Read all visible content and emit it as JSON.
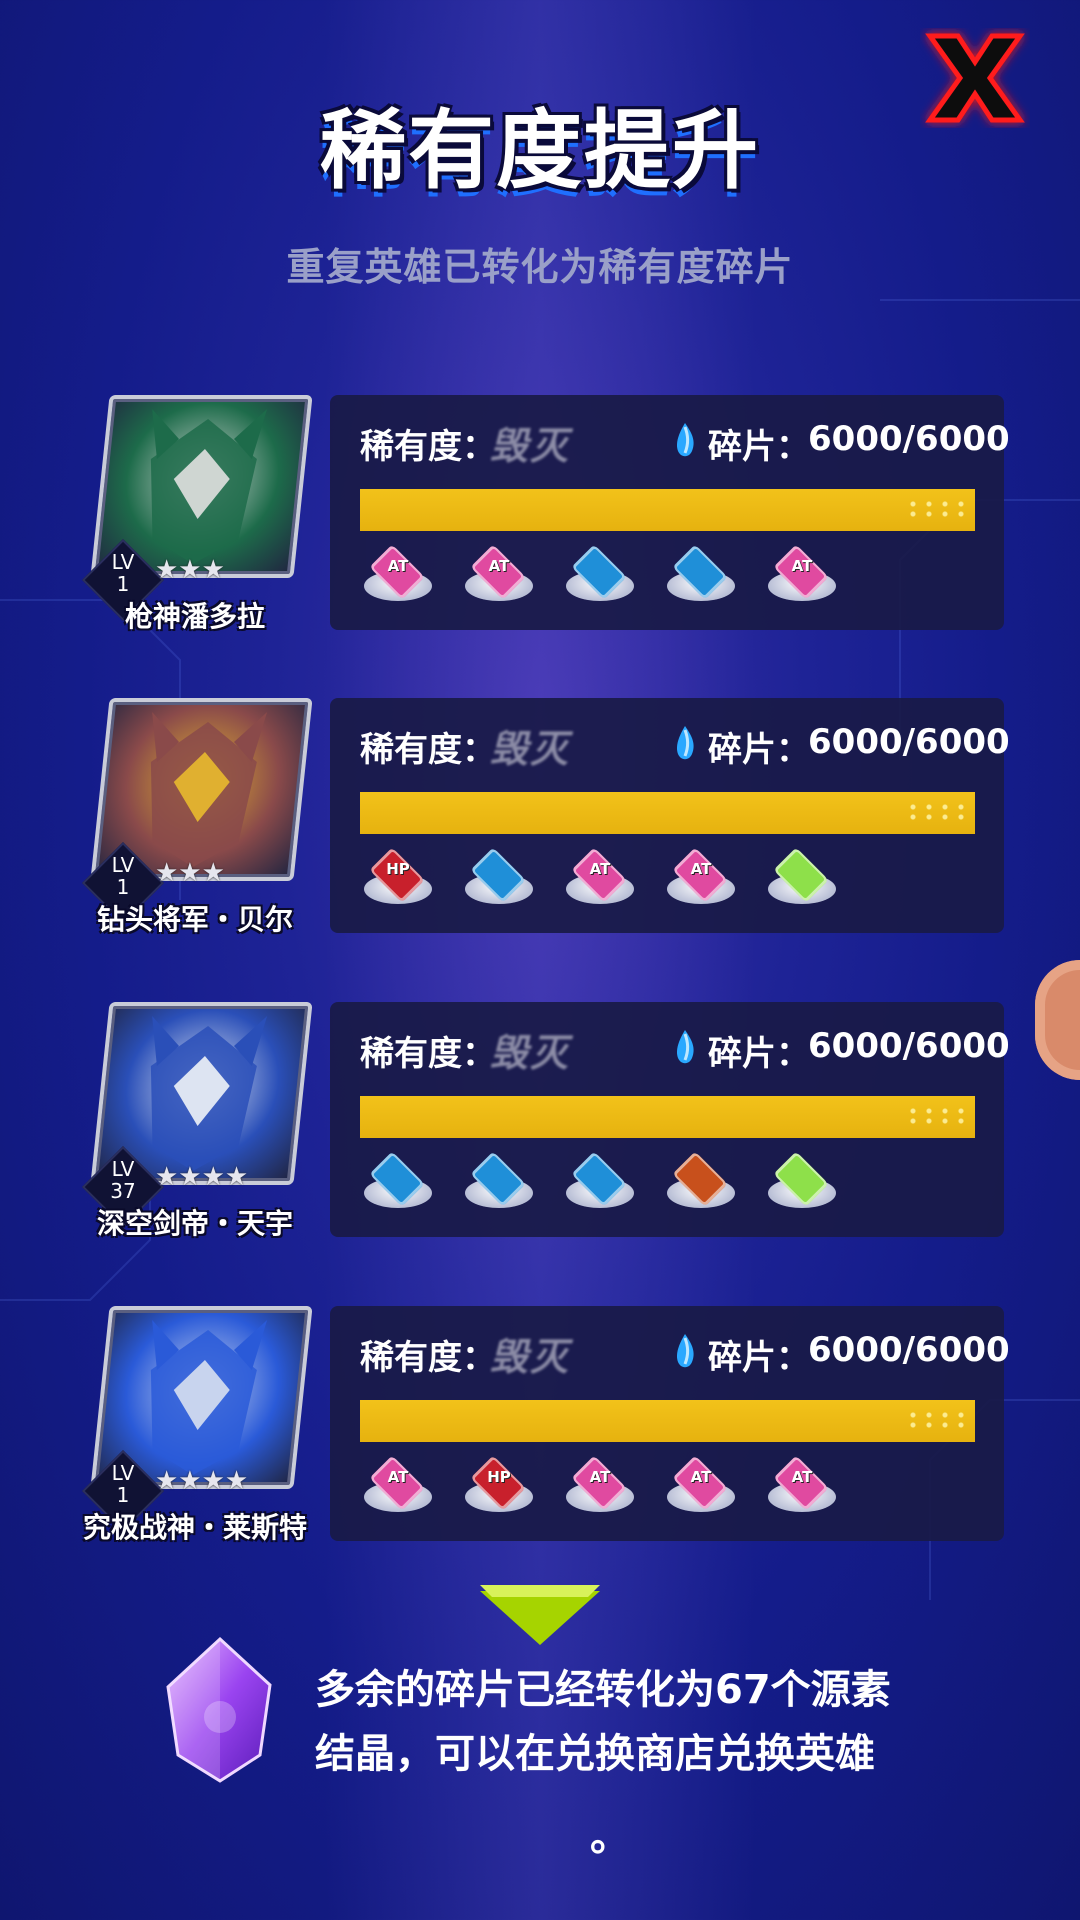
{
  "header": {
    "title": "稀有度提升",
    "subtitle": "重复英雄已转化为稀有度碎片",
    "close_icon": "close-x-icon"
  },
  "labels": {
    "rarity_label": "稀有度：",
    "fragment_label": "碎片："
  },
  "heroes": [
    {
      "name": "枪神潘多拉",
      "lv_label": "LV",
      "level": "1",
      "stars": "★★★",
      "rarity": "毁灭",
      "fragments": "6000/6000",
      "progress": 1.0,
      "portrait_colors": [
        "#1d6b4a",
        "#cfd6d2"
      ],
      "chips": [
        {
          "icon": "atk-chip-icon",
          "text": "AT",
          "color": "#e04aa0"
        },
        {
          "icon": "atk-chip-icon",
          "text": "AT",
          "color": "#e04aa0"
        },
        {
          "icon": "star-chip-icon",
          "text": "",
          "color": "#1f8fd8"
        },
        {
          "icon": "star-chip-icon",
          "text": "",
          "color": "#1f8fd8"
        },
        {
          "icon": "atk-chip-icon",
          "text": "AT",
          "color": "#e04aa0"
        }
      ]
    },
    {
      "name": "钻头将军・贝尔",
      "lv_label": "LV",
      "level": "1",
      "stars": "★★★",
      "rarity": "毁灭",
      "fragments": "6000/6000",
      "progress": 1.0,
      "portrait_colors": [
        "#8a4a4a",
        "#e0b030"
      ],
      "chips": [
        {
          "icon": "hp-chip-icon",
          "text": "HP",
          "color": "#c8202c"
        },
        {
          "icon": "star-chip-icon",
          "text": "",
          "color": "#1f8fd8"
        },
        {
          "icon": "atk-chip-icon",
          "text": "AT",
          "color": "#e04aa0"
        },
        {
          "icon": "atk-chip-icon",
          "text": "AT",
          "color": "#e04aa0"
        },
        {
          "icon": "sparkle-chip-icon",
          "text": "",
          "color": "#8ee04a"
        }
      ]
    },
    {
      "name": "深空剑帝・天宇",
      "lv_label": "LV",
      "level": "37",
      "stars": "★★★★",
      "rarity": "毁灭",
      "fragments": "6000/6000",
      "progress": 1.0,
      "portrait_colors": [
        "#2a4fb8",
        "#dde4f2"
      ],
      "chips": [
        {
          "icon": "star-chip-icon",
          "text": "",
          "color": "#1f8fd8"
        },
        {
          "icon": "star-chip-icon",
          "text": "",
          "color": "#1f8fd8"
        },
        {
          "icon": "star-chip-icon",
          "text": "",
          "color": "#1f8fd8"
        },
        {
          "icon": "crit-chip-icon",
          "text": "",
          "color": "#c8501c"
        },
        {
          "icon": "sparkle-chip-icon",
          "text": "",
          "color": "#8ee04a"
        }
      ]
    },
    {
      "name": "究极战神・莱斯特",
      "lv_label": "LV",
      "level": "1",
      "stars": "★★★★",
      "rarity": "毁灭",
      "fragments": "6000/6000",
      "progress": 1.0,
      "portrait_colors": [
        "#2a5ad8",
        "#c8d4ee"
      ],
      "chips": [
        {
          "icon": "atk-chip-icon",
          "text": "AT",
          "color": "#e04aa0"
        },
        {
          "icon": "hp-chip-icon",
          "text": "HP",
          "color": "#c8202c"
        },
        {
          "icon": "atk-chip-icon",
          "text": "AT",
          "color": "#e04aa0"
        },
        {
          "icon": "atk-chip-icon",
          "text": "AT",
          "color": "#e04aa0"
        },
        {
          "icon": "atk-chip-icon",
          "text": "AT",
          "color": "#e04aa0"
        }
      ]
    }
  ],
  "footer": {
    "note_line1": "多余的碎片已经转化为67个源素",
    "note_line2": "结晶，可以在兑换商店兑换英雄",
    "note_tail": "。",
    "crystal_icon": "source-crystal-icon",
    "arrow_icon": "down-arrow-icon"
  },
  "colors": {
    "accent_yellow": "#f2c21a",
    "panel_bg": "#191a46",
    "close_red": "#ff1a1a"
  }
}
